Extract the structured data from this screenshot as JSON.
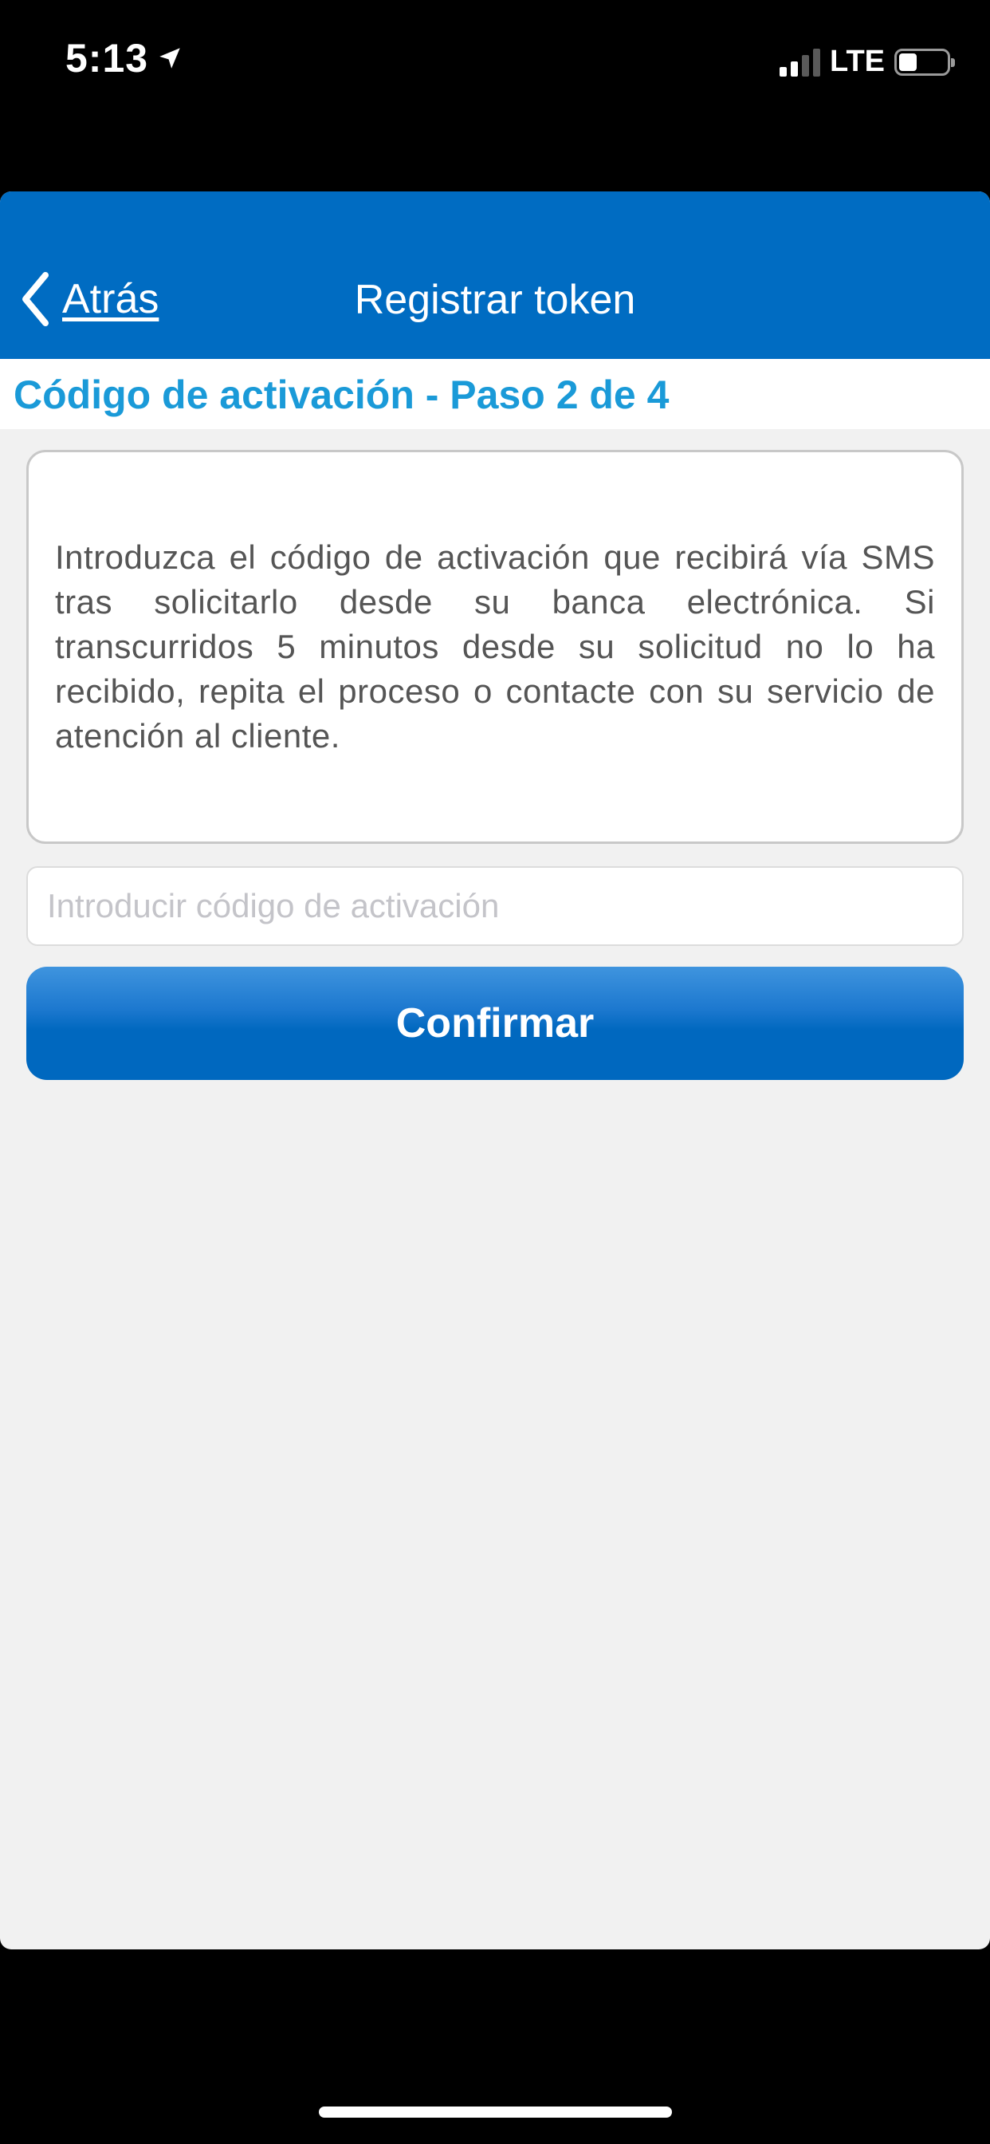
{
  "status_bar": {
    "time": "5:13",
    "network": "LTE",
    "icons": [
      "location-arrow-icon",
      "signal-icon",
      "battery-icon"
    ]
  },
  "navbar": {
    "back_label": "Atrás",
    "title": "Registrar token",
    "background_color": "#006cc2"
  },
  "step": {
    "title": "Código de activación - Paso 2 de 4",
    "color": "#1a9ad8"
  },
  "info": {
    "text": "Introduzca el código de activación que recibirá vía SMS tras solicitarlo desde su banca electrónica. Si transcurridos 5 minutos desde su solicitud no lo ha recibido, repita el proceso o contacte con su servicio de atención al cliente."
  },
  "activation_input": {
    "value": "",
    "placeholder": "Introducir código de activación"
  },
  "confirm_button": {
    "label": "Confirmar"
  }
}
